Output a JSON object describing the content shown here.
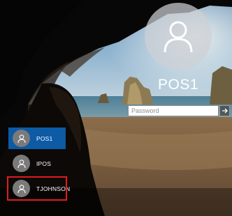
{
  "lock_screen": {
    "selected_user_name": "POS1",
    "password_placeholder": "Password",
    "password_value": "",
    "submit_icon": "arrow-right-icon",
    "avatar_icon": "user-silhouette-icon"
  },
  "user_list": [
    {
      "name": "POS1",
      "state": "selected"
    },
    {
      "name": "IPOS",
      "state": "normal"
    },
    {
      "name": "TJOHNSON",
      "state": "highlighted"
    }
  ],
  "colors": {
    "selected_bg": "#0d5aa5",
    "highlight_outline": "#e11c1c",
    "avatar_bg": "#cdd0d4"
  }
}
